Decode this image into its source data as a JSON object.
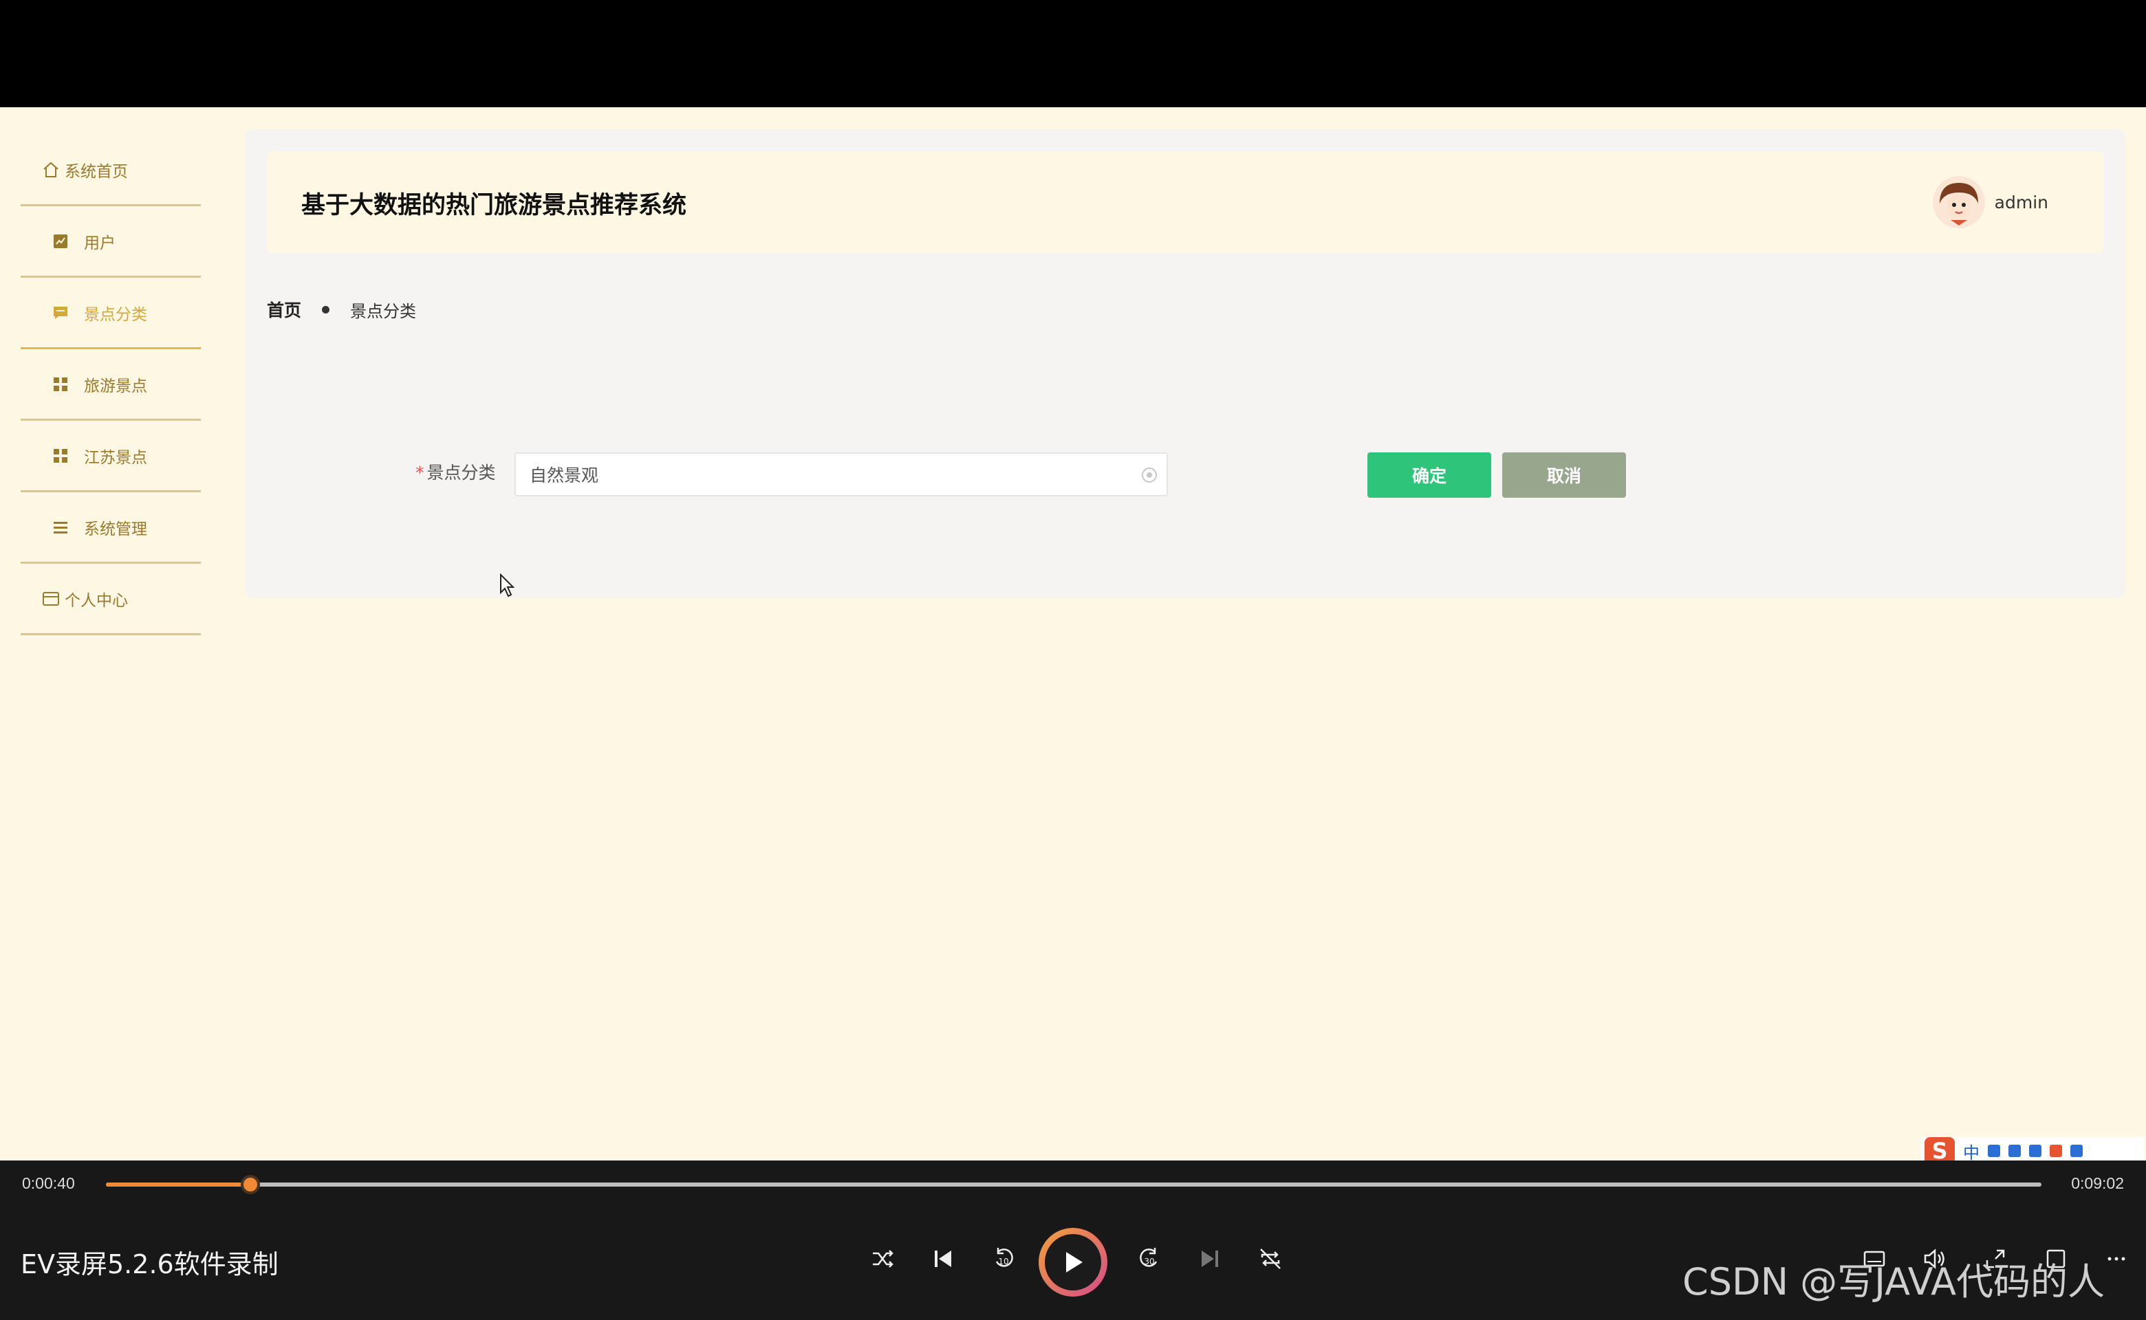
{
  "app": {
    "title": "基于大数据的热门旅游景点推荐系统",
    "username": "admin"
  },
  "sidebar": {
    "items": [
      {
        "label": "系统首页",
        "icon": "home-icon"
      },
      {
        "label": "用户",
        "icon": "chart-icon"
      },
      {
        "label": "景点分类",
        "icon": "message-icon",
        "active": true
      },
      {
        "label": "旅游景点",
        "icon": "grid-icon"
      },
      {
        "label": "江苏景点",
        "icon": "grid-icon"
      },
      {
        "label": "系统管理",
        "icon": "list-icon"
      },
      {
        "label": "个人中心",
        "icon": "card-icon"
      }
    ]
  },
  "breadcrumb": {
    "home": "首页",
    "current": "景点分类"
  },
  "form": {
    "field_label": "景点分类",
    "required_mark": "*",
    "field_value": "自然景观",
    "confirm_label": "确定",
    "cancel_label": "取消"
  },
  "ime": {
    "lang": "中"
  },
  "player": {
    "current_time": "0:00:40",
    "total_time": "0:09:02",
    "progress": 0.074,
    "recorder_title": "EV录屏5.2.6软件录制",
    "watermark": "CSDN @写JAVA代码的人"
  },
  "colors": {
    "background": "#fef7e3",
    "accent_active": "#d4a93a",
    "confirm": "#2ec57a",
    "cancel": "#98a68e",
    "progress": "#f08a35"
  }
}
